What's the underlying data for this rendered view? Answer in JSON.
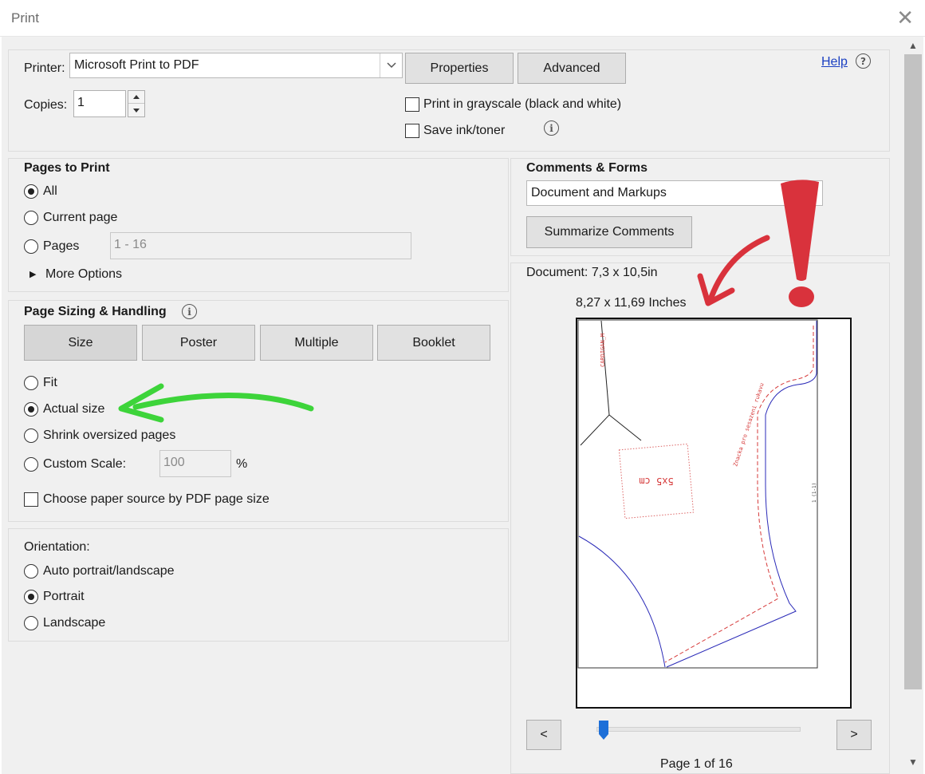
{
  "window": {
    "title": "Print"
  },
  "printer_section": {
    "printer_label": "Printer:",
    "printer_value": "Microsoft Print to PDF",
    "properties_label": "Properties",
    "advanced_label": "Advanced",
    "help_label": "Help",
    "copies_label": "Copies:",
    "copies_value": "1",
    "grayscale_label": "Print in grayscale (black and white)",
    "grayscale_checked": false,
    "save_ink_label": "Save ink/toner",
    "save_ink_checked": false
  },
  "pages_to_print": {
    "heading": "Pages to Print",
    "options": [
      {
        "label": "All",
        "checked": true
      },
      {
        "label": "Current page",
        "checked": false
      },
      {
        "label": "Pages",
        "checked": false
      }
    ],
    "pages_placeholder": "1 - 16",
    "more_options_label": "More Options"
  },
  "page_sizing": {
    "heading": "Page Sizing & Handling",
    "tabs": [
      "Size",
      "Poster",
      "Multiple",
      "Booklet"
    ],
    "options": [
      {
        "label": "Fit",
        "checked": false
      },
      {
        "label": "Actual size",
        "checked": true
      },
      {
        "label": "Shrink oversized pages",
        "checked": false
      },
      {
        "label": "Custom Scale:",
        "checked": false
      }
    ],
    "custom_scale_value": "100",
    "custom_scale_unit": "%",
    "paper_source_label": "Choose paper source by PDF page size",
    "paper_source_checked": false
  },
  "orientation": {
    "heading": "Orientation:",
    "options": [
      {
        "label": "Auto portrait/landscape",
        "checked": false
      },
      {
        "label": "Portrait",
        "checked": true
      },
      {
        "label": "Landscape",
        "checked": false
      }
    ]
  },
  "comments_forms": {
    "heading": "Comments & Forms",
    "select_value": "Document and Markups",
    "summarize_label": "Summarize Comments"
  },
  "preview": {
    "document_size": "Document: 7,3 x 10,5in",
    "paper_size": "8,27 x 11,69 Inches",
    "pattern_text_1": "CARDIGAN_M",
    "pattern_text_2": "Znacka pro sesazeni rukavu",
    "pattern_text_3": "5x5 cm",
    "pattern_text_4": "1 (1-1)",
    "prev_label": "<",
    "next_label": ">",
    "page_indicator": "Page 1 of 16",
    "slider_position": 0
  },
  "colors": {
    "dialog_bg": "#f0f0f0",
    "annotation_red": "#d9323c",
    "annotation_green": "#3dd43a",
    "slider_blue": "#1d6fd8",
    "link_blue": "#1a3fc2"
  }
}
